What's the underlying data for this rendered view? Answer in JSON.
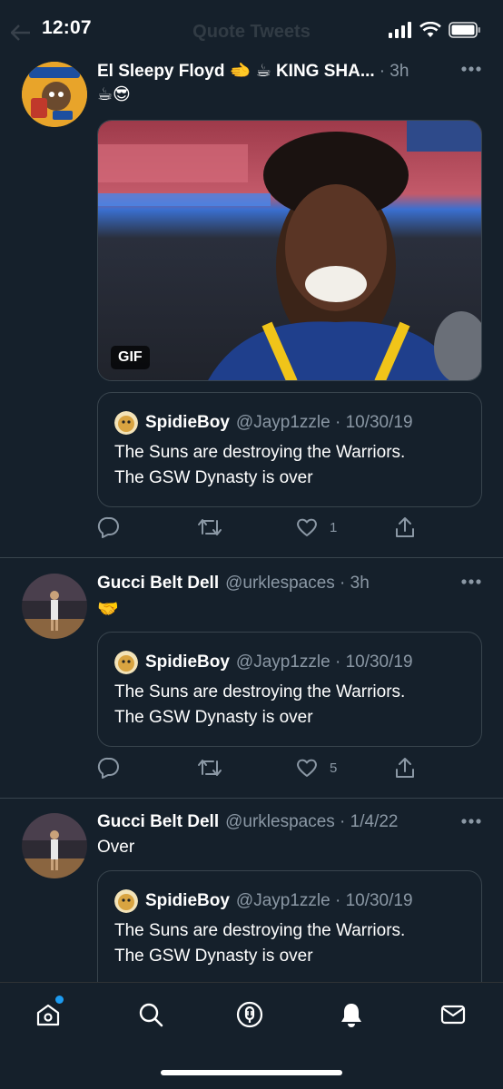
{
  "status_bar": {
    "time": "12:07"
  },
  "header": {
    "title": "Quote Tweets"
  },
  "tweets": [
    {
      "name": "El Sleepy Floyd 🫲 ☕ KING SHA...",
      "meta": "· 3h",
      "text": "☕😎",
      "media_badge": "GIF",
      "quote": {
        "name": "SpidieBoy",
        "handle": "@Jayp1zzle · 10/30/19",
        "text": "The Suns are destroying the Warriors.\nThe GSW Dynasty is over"
      },
      "actions": {
        "likes": "1"
      }
    },
    {
      "name": "Gucci Belt Dell",
      "handle": "@urklespaces · 3h",
      "text": "🤝",
      "quote": {
        "name": "SpidieBoy",
        "handle": "@Jayp1zzle · 10/30/19",
        "text": "The Suns are destroying the Warriors.\nThe GSW Dynasty is over"
      },
      "actions": {
        "likes": "5"
      }
    },
    {
      "name": "Gucci Belt Dell",
      "handle": "@urklespaces · 1/4/22",
      "text": "Over",
      "quote": {
        "name": "SpidieBoy",
        "handle": "@Jayp1zzle · 10/30/19",
        "text": "The Suns are destroying the Warriors.\nThe GSW Dynasty is over"
      }
    }
  ],
  "tab_bar": {
    "items": [
      "home-icon",
      "search-icon",
      "spaces-icon",
      "notifications-icon",
      "messages-icon"
    ]
  },
  "colors": {
    "background": "#15202b",
    "border": "#38444d",
    "secondary_text": "#8b98a5",
    "accent": "#1d9bf0"
  }
}
